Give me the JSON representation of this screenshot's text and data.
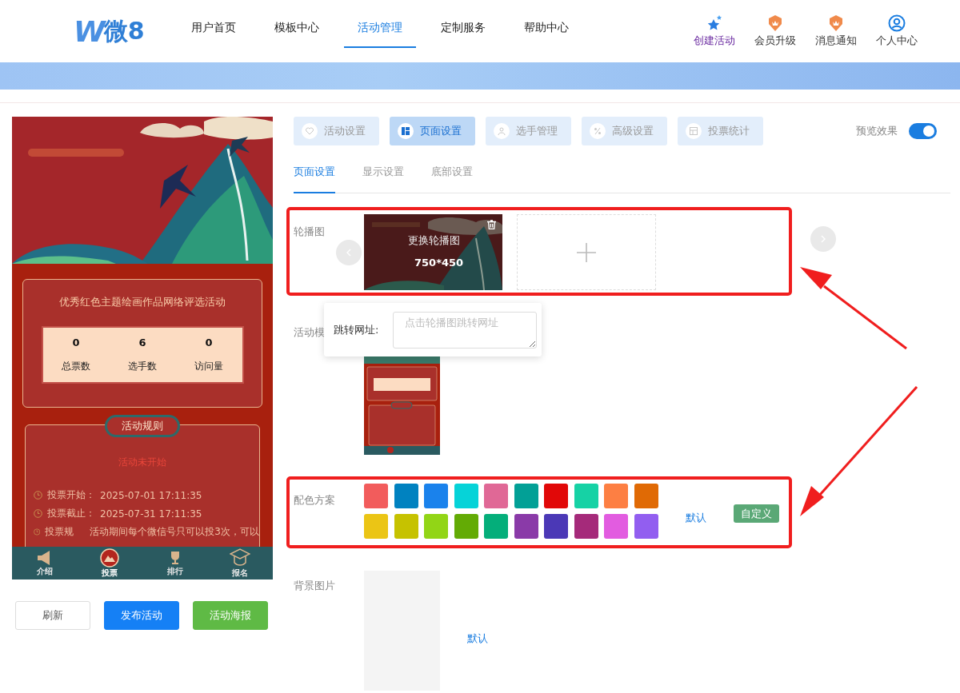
{
  "header": {
    "logo": {
      "mark": "W",
      "text": "微8"
    },
    "nav": [
      {
        "label": "用户首页",
        "selected": false
      },
      {
        "label": "模板中心",
        "selected": false
      },
      {
        "label": "活动管理",
        "selected": true
      },
      {
        "label": "定制服务",
        "selected": false
      },
      {
        "label": "帮助中心",
        "selected": false
      }
    ],
    "actions": [
      {
        "label": "创建活动",
        "kind": "create"
      },
      {
        "label": "会员升级",
        "kind": "vip"
      },
      {
        "label": "消息通知",
        "kind": "notice"
      },
      {
        "label": "个人中心",
        "kind": "user"
      }
    ]
  },
  "preview": {
    "title": "优秀红色主题绘画作品网络评选活动",
    "stats": [
      {
        "value": "0",
        "label": "总票数"
      },
      {
        "value": "6",
        "label": "选手数"
      },
      {
        "value": "0",
        "label": "访问量"
      }
    ],
    "rules_title": "活动规则",
    "status": "活动未开始",
    "rules": [
      {
        "label": "投票开始：",
        "value": "2025-07-01 17:11:35"
      },
      {
        "label": "投票截止：",
        "value": "2025-07-31 17:11:35"
      },
      {
        "label": "投票规",
        "value": "活动期间每个微信号只可以投3次，可以"
      }
    ],
    "tabbar": [
      {
        "label": "介绍",
        "kind": "intro",
        "selected": false
      },
      {
        "label": "投票",
        "kind": "vote",
        "selected": true
      },
      {
        "label": "排行",
        "kind": "rank",
        "selected": false
      },
      {
        "label": "报名",
        "kind": "signup",
        "selected": false
      }
    ]
  },
  "buttons": [
    {
      "label": "刷新",
      "kind": "plain"
    },
    {
      "label": "发布活动",
      "kind": "primary"
    },
    {
      "label": "活动海报",
      "kind": "success"
    }
  ],
  "tabs": [
    {
      "label": "活动设置",
      "kind": "activity",
      "selected": false
    },
    {
      "label": "页面设置",
      "kind": "page",
      "selected": true
    },
    {
      "label": "选手管理",
      "kind": "players",
      "selected": false
    },
    {
      "label": "高级设置",
      "kind": "advanced",
      "selected": false
    },
    {
      "label": "投票统计",
      "kind": "stats",
      "selected": false
    }
  ],
  "preview_toggle": {
    "label": "预览效果",
    "on": true
  },
  "subtabs": [
    {
      "label": "页面设置",
      "selected": true
    },
    {
      "label": "显示设置",
      "selected": false
    },
    {
      "label": "底部设置",
      "selected": false
    }
  ],
  "carousel": {
    "label": "轮播图",
    "overlay": "更换轮播图",
    "size": "750*450",
    "link_label": "跳转网址:",
    "link_placeholder": "点击轮播图跳转网址"
  },
  "template": {
    "label": "活动模"
  },
  "colors": {
    "label": "配色方案",
    "default_link": "默认",
    "custom_button": "自定义",
    "swatches": [
      {
        "color": "#f25c5c"
      },
      {
        "color": "#0082c0"
      },
      {
        "color": "#1a82ec"
      },
      {
        "color": "#06d3d8"
      },
      {
        "color": "#e06896"
      },
      {
        "color": "#02a096"
      },
      {
        "color": "#e10808"
      },
      {
        "color": "#16d2a5"
      },
      {
        "color": "#fd7f43"
      },
      {
        "color": "#e06a05"
      },
      {
        "color": "#ebc515"
      },
      {
        "color": "#c6c200"
      },
      {
        "color": "#92d516"
      },
      {
        "color": "#63ab05"
      },
      {
        "color": "#04ae7a"
      },
      {
        "color": "#8a3aa8"
      },
      {
        "color": "#4b38b6"
      },
      {
        "color": "#a52a7a"
      },
      {
        "color": "#e25ce0"
      },
      {
        "color": "#925ef0"
      }
    ]
  },
  "background": {
    "label": "背景图片",
    "default_link": "默认"
  }
}
